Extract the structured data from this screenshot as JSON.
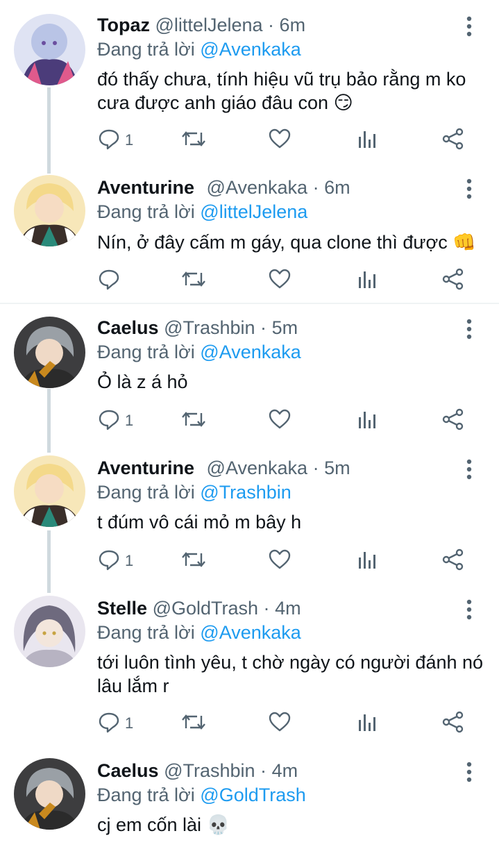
{
  "tweets": [
    {
      "name": "Topaz",
      "handle": "@littelJelena",
      "dot": "·",
      "time": "6m",
      "reply_prefix": "Đang trả lời",
      "reply_to": "@Avenkaka",
      "text": "đó thấy chưa, tính hiệu vũ trụ bảo rằng m ko cưa được anh giáo đâu con 😏",
      "reply_count": "1",
      "avatar_colors": [
        "#b9c4e6",
        "#e05a8c",
        "#4b3c7a"
      ]
    },
    {
      "name": "Aventurine",
      "handle": "@Avenkaka",
      "dot": "·",
      "time": "6m",
      "reply_prefix": "Đang trả lời",
      "reply_to": "@littelJelena",
      "text": "Nín, ở đây cấm m gáy, qua clone thì được 👊",
      "reply_count": "",
      "avatar_colors": [
        "#f4d98a",
        "#2a8a7a",
        "#3a2f2a"
      ]
    },
    {
      "name": "Caelus",
      "handle": "@Trashbin",
      "dot": "·",
      "time": "5m",
      "reply_prefix": "Đang trả lời",
      "reply_to": "@Avenkaka",
      "text": "Ỏ là z á hỏ",
      "reply_count": "1",
      "avatar_colors": [
        "#9aa0a6",
        "#c9891e",
        "#2b2b2b"
      ]
    },
    {
      "name": "Aventurine",
      "handle": "@Avenkaka",
      "dot": "·",
      "time": "5m",
      "reply_prefix": "Đang trả lời",
      "reply_to": "@Trashbin",
      "text": "t đúm vô cái mỏ m bây h",
      "reply_count": "1",
      "avatar_colors": [
        "#f4d98a",
        "#2a8a7a",
        "#3a2f2a"
      ]
    },
    {
      "name": "Stelle",
      "handle": "@GoldTrash",
      "dot": "·",
      "time": "4m",
      "reply_prefix": "Đang trả lời",
      "reply_to": "@Avenkaka",
      "text": "tới luôn tình yêu, t chờ ngày có người đánh nó lâu lắm r",
      "reply_count": "1",
      "avatar_colors": [
        "#b7b3c2",
        "#6e6a7e",
        "#e9e6ef"
      ]
    },
    {
      "name": "Caelus",
      "handle": "@Trashbin",
      "dot": "·",
      "time": "4m",
      "reply_prefix": "Đang trả lời",
      "reply_to": "@GoldTrash",
      "text": "cj em cốn lài 💀",
      "reply_count": "",
      "avatar_colors": [
        "#9aa0a6",
        "#c9891e",
        "#2b2b2b"
      ]
    }
  ],
  "icons": {
    "reply": "reply-icon",
    "retweet": "retweet-icon",
    "like": "heart-icon",
    "views": "views-icon",
    "share": "share-icon",
    "more": "more-icon"
  },
  "colors": {
    "text": "#0f1419",
    "muted": "#536471",
    "mention": "#1d9bf0",
    "thread": "#cfd9de"
  }
}
